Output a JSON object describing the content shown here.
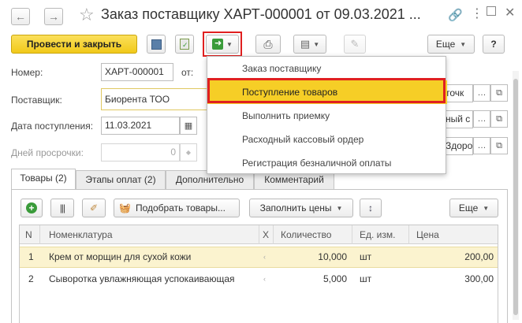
{
  "window": {
    "title": "Заказ поставщику ХАРТ-000001 от 09.03.2021 ..."
  },
  "toolbar": {
    "post_close_label": "Провести и закрыть",
    "more_label": "Еще",
    "help_label": "?"
  },
  "dropdown_menu": {
    "items": [
      "Заказ поставщику",
      "Поступление товаров",
      "Выполнить приемку",
      "Расходный кассовый ордер",
      "Регистрация безналичной оплаты"
    ],
    "highlighted_index": 1
  },
  "form": {
    "number_label": "Номер:",
    "number_value": "ХАРТ-000001",
    "from_label": "от:",
    "supplier_label": "Поставщик:",
    "supplier_value": "Биорента ТОО",
    "receipt_date_label": "Дата поступления:",
    "receipt_date_value": "11.03.2021",
    "overdue_days_label": "Дней просрочки:",
    "overdue_days_value": "0",
    "right_field_1": "точк",
    "right_field_2": "ный с",
    "right_field_3": "Здоро"
  },
  "tabs": [
    "Товары (2)",
    "Этапы оплат (2)",
    "Дополнительно",
    "Комментарий"
  ],
  "table_toolbar": {
    "pick_goods_label": "Подобрать товары...",
    "fill_prices_label": "Заполнить цены",
    "more_label": "Еще"
  },
  "table": {
    "columns": [
      "N",
      "Номенклатура",
      "Х",
      "Количество",
      "Ед. изм.",
      "Цена"
    ],
    "rows": [
      {
        "n": "1",
        "name": "Крем от морщин для сухой кожи",
        "x": "‹",
        "qty": "10,000",
        "unit": "шт",
        "price": "200,00"
      },
      {
        "n": "2",
        "name": "Сыворотка увлажняющая успокаивающая",
        "x": "‹",
        "qty": "5,000",
        "unit": "шт",
        "price": "300,00"
      }
    ]
  },
  "colors": {
    "primary_button": "#f5d22b",
    "highlight_row": "#fdf6d3",
    "menu_selected": "#f6ce26",
    "red_outline": "#e02020",
    "green_icon": "#3a9b3a"
  }
}
